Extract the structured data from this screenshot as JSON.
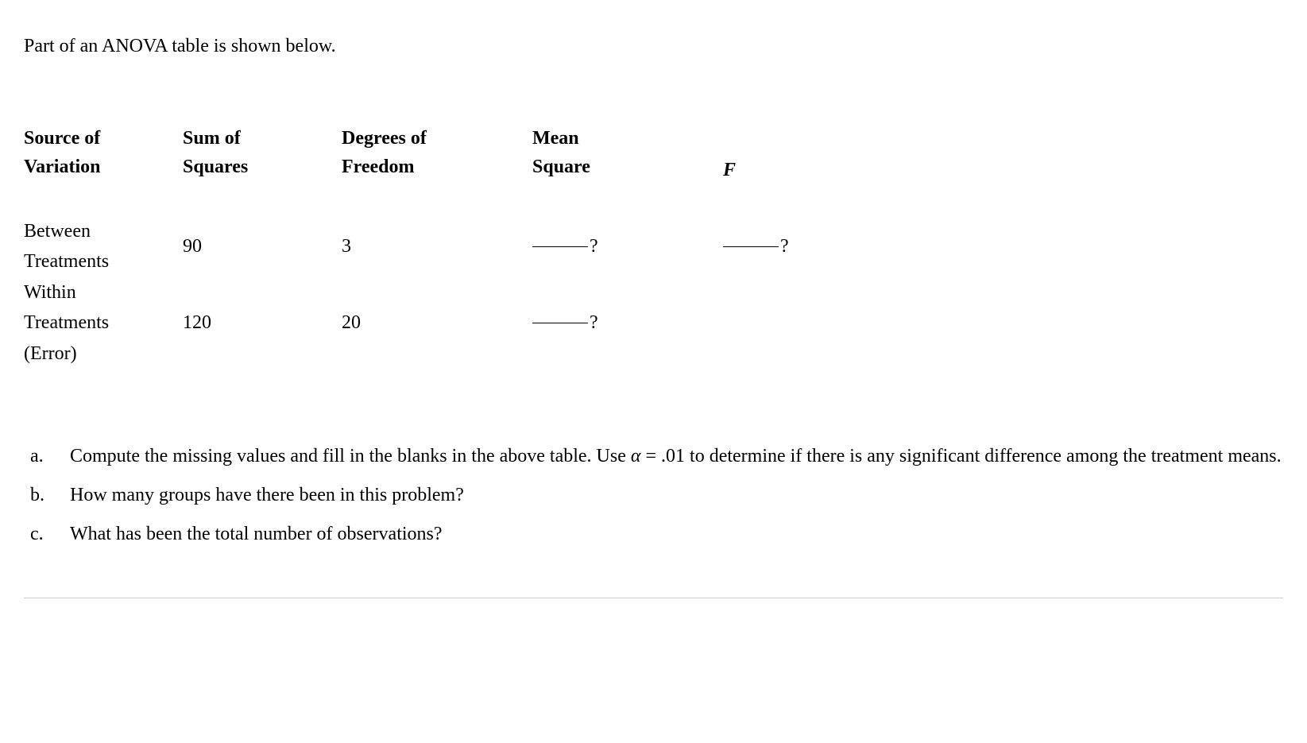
{
  "intro": "Part of an ANOVA table is shown below.",
  "headers": {
    "col1_line1": "Source of",
    "col1_line2": "Variation",
    "col2_line1": "Sum of",
    "col2_line2": "Squares",
    "col3_line1": "Degrees of",
    "col3_line2": "Freedom",
    "col4_line1": "Mean",
    "col4_line2": "Square",
    "col5": "F"
  },
  "rows": {
    "between": {
      "label_line1": "Between",
      "label_line2": "Treatments",
      "ss": "90",
      "df": "3",
      "ms": "?",
      "f": "?"
    },
    "within": {
      "label_line1": "Within",
      "label_line2": "Treatments",
      "label_line3": "(Error)",
      "ss": "120",
      "df": "20",
      "ms": "?",
      "f": ""
    }
  },
  "questions": {
    "a": {
      "label": "a.",
      "text_part1": "Compute the missing values and fill in the blanks in the above table. Use ",
      "alpha": "α",
      "text_part2": " = .01 to determine if there is any significant difference among the treatment means."
    },
    "b": {
      "label": "b.",
      "text": "How many groups have there been in this problem?"
    },
    "c": {
      "label": "c.",
      "text": "What has been the total number of observations?"
    }
  }
}
